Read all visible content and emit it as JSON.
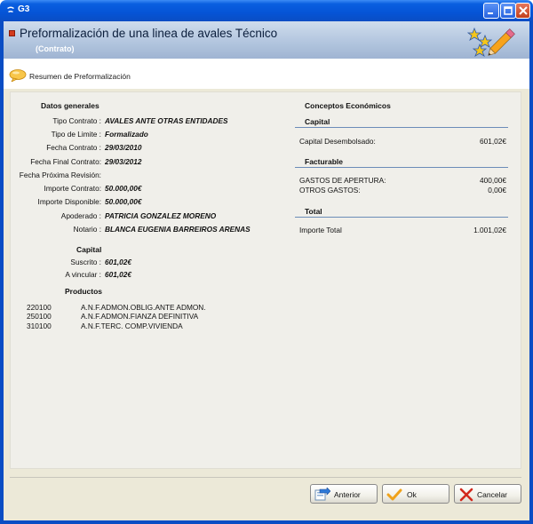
{
  "window": {
    "title": "G3"
  },
  "header": {
    "title": "Preformalización de una linea de avales Técnico",
    "subtitle": "(Contrato)"
  },
  "breadcrumb": {
    "label": "Resumen de Preformalización"
  },
  "datos_generales": {
    "heading": "Datos generales",
    "fields": [
      {
        "label": "Tipo Contrato :",
        "value": "AVALES ANTE OTRAS ENTIDADES"
      },
      {
        "label": "Tipo de Limite :",
        "value": "Formalizado"
      },
      {
        "label": "Fecha Contrato :",
        "value": "29/03/2010"
      },
      {
        "label": "Fecha Final Contrato:",
        "value": "29/03/2012"
      },
      {
        "label": "Fecha Próxima Revisión:",
        "value": ""
      },
      {
        "label": "Importe Contrato:",
        "value": "50.000,00€"
      },
      {
        "label": "Importe Disponible:",
        "value": "50.000,00€"
      },
      {
        "label": "Apoderado :",
        "value": "PATRICIA GONZALEZ MORENO"
      },
      {
        "label": "Notario :",
        "value": "BLANCA EUGENIA BARREIROS ARENAS"
      }
    ]
  },
  "capital": {
    "heading": "Capital",
    "fields": [
      {
        "label": "Suscrito :",
        "value": "601,02€"
      },
      {
        "label": "A vincular :",
        "value": "601,02€"
      }
    ]
  },
  "productos": {
    "heading": "Productos",
    "items": [
      {
        "code": "220100",
        "name": "A.N.F.ADMON.OBLIG.ANTE ADMON."
      },
      {
        "code": "250100",
        "name": "A.N.F.ADMON.FIANZA DEFINITIVA"
      },
      {
        "code": "310100",
        "name": "A.N.F.TERC. COMP.VIVIENDA"
      }
    ]
  },
  "conceptos": {
    "heading": "Conceptos Económicos",
    "capital": {
      "heading": "Capital",
      "rows": [
        {
          "label": "Capital Desembolsado:",
          "amount": "601,02€"
        }
      ]
    },
    "facturable": {
      "heading": "Facturable",
      "rows": [
        {
          "label": "GASTOS DE APERTURA:",
          "amount": "400,00€"
        },
        {
          "label": "OTROS GASTOS:",
          "amount": "0,00€"
        }
      ]
    },
    "total": {
      "heading": "Total",
      "rows": [
        {
          "label": "Importe Total",
          "amount": "1.001,02€"
        }
      ]
    }
  },
  "buttons": {
    "anterior": "Anterior",
    "ok": "Ok",
    "cancelar": "Cancelar"
  }
}
